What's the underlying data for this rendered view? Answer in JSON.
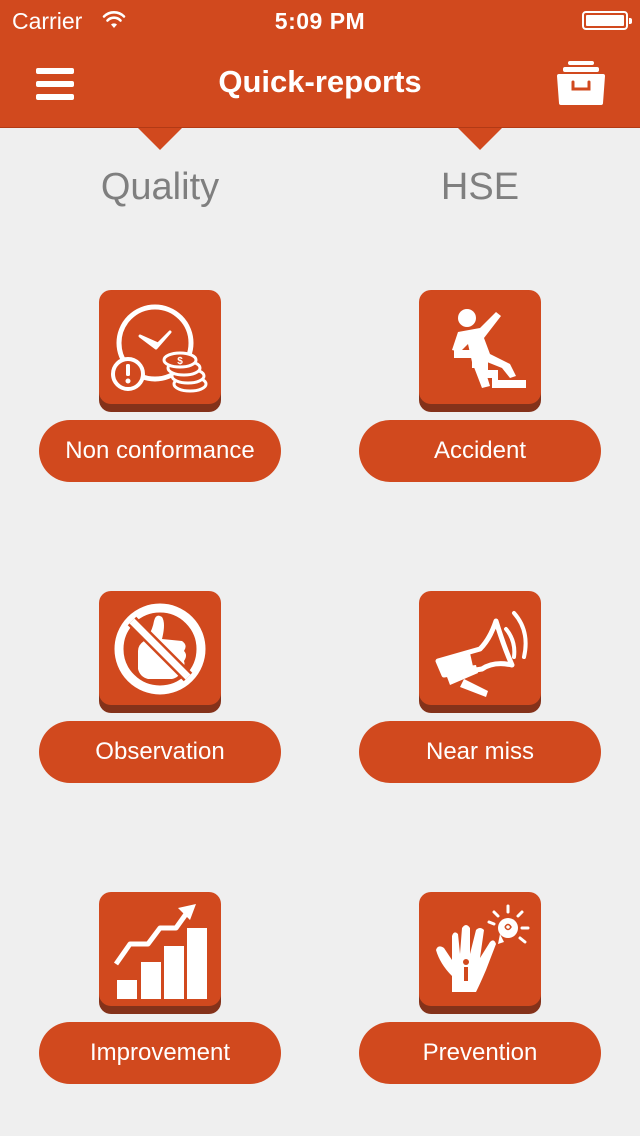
{
  "status_bar": {
    "carrier": "Carrier",
    "time": "5:09 PM",
    "battery_level": 1.0
  },
  "nav": {
    "title": "Quick-reports",
    "left_icon": "menu-icon",
    "right_icon": "archive-icon"
  },
  "columns": [
    {
      "title": "Quality",
      "items": [
        {
          "label": "Non conformance",
          "icon": "clock-coins-alert-icon"
        },
        {
          "label": "Observation",
          "icon": "no-thumbs-up-icon"
        },
        {
          "label": "Improvement",
          "icon": "growth-chart-icon"
        }
      ]
    },
    {
      "title": "HSE",
      "items": [
        {
          "label": "Accident",
          "icon": "falling-on-stairs-icon"
        },
        {
          "label": "Near miss",
          "icon": "megaphone-icon"
        },
        {
          "label": "Prevention",
          "icon": "hand-lightbulb-icon"
        }
      ]
    }
  ],
  "colors": {
    "accent": "#d1491e",
    "accent_shadow": "#84321a",
    "background": "#efefef",
    "column_title": "#7f7f7f"
  }
}
